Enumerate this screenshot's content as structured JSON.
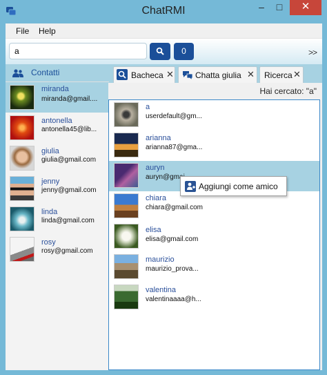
{
  "window": {
    "title": "ChatRMI",
    "colors": {
      "frame": "#75b9d7",
      "accent": "#1b4f99",
      "close": "#c7463a",
      "selection": "#a7d2e2"
    }
  },
  "menu": {
    "file": "File",
    "help": "Help"
  },
  "search": {
    "value": "a",
    "count": "0",
    "expand_label": ">>"
  },
  "contacts_header": "Contatti",
  "contacts": [
    {
      "name": "miranda",
      "email": "miranda@gmail....",
      "selected": true
    },
    {
      "name": "antonella",
      "email": "antonella45@lib..."
    },
    {
      "name": "giulia",
      "email": "giulia@gmail.com"
    },
    {
      "name": "jenny",
      "email": "jenny@gmail.com"
    },
    {
      "name": "linda",
      "email": "linda@gmail.com"
    },
    {
      "name": "rosy",
      "email": "rosy@gmail.com"
    }
  ],
  "tabs": [
    {
      "label": "Bacheca",
      "icon": "search-icon"
    },
    {
      "label": "Chatta giulia",
      "icon": "chat-icon"
    },
    {
      "label": "Ricerca"
    }
  ],
  "search_info": "Hai cercato: \"a\"",
  "results": [
    {
      "name": "a",
      "email": "userdefault@gm..."
    },
    {
      "name": "arianna",
      "email": "arianna87@gma..."
    },
    {
      "name": "auryn",
      "email": "auryn@gmai",
      "highlighted": true
    },
    {
      "name": "chiara",
      "email": "chiara@gmail.com"
    },
    {
      "name": "elisa",
      "email": "elisa@gmail.com"
    },
    {
      "name": "maurizio",
      "email": "maurizio_prova..."
    },
    {
      "name": "valentina",
      "email": "valentinaaaa@h..."
    }
  ],
  "context_menu": {
    "add_friend": "Aggiungi come amico"
  }
}
